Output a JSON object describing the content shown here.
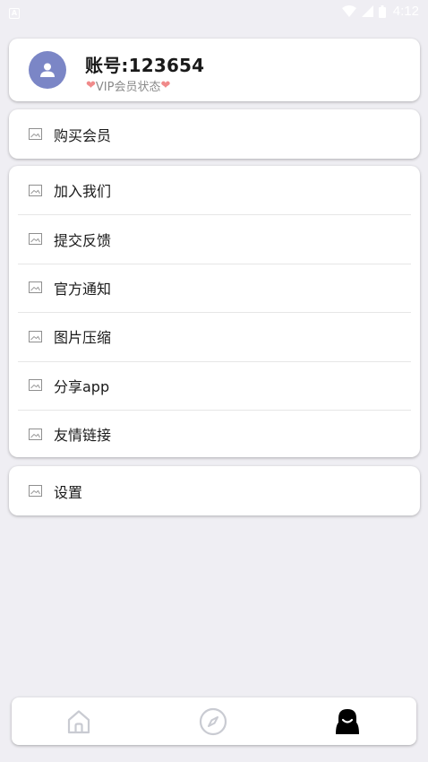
{
  "status_bar": {
    "notification_icon": "a-box-icon",
    "wifi_icon": "wifi-icon",
    "signal_icon": "signal-icon",
    "battery_icon": "battery-icon",
    "time": "4:12"
  },
  "profile": {
    "avatar_icon": "user-icon",
    "account_title": "账号:123654",
    "vip_status": "VIP会员状态",
    "heart_color": "#f08a8a"
  },
  "buy_section": {
    "items": [
      {
        "label": "购买会员",
        "icon": "image-placeholder-icon"
      }
    ]
  },
  "list_section": {
    "items": [
      {
        "label": "加入我们",
        "icon": "image-placeholder-icon"
      },
      {
        "label": "提交反馈",
        "icon": "image-placeholder-icon"
      },
      {
        "label": "官方通知",
        "icon": "image-placeholder-icon"
      },
      {
        "label": "图片压缩",
        "icon": "image-placeholder-icon"
      },
      {
        "label": "分享app",
        "icon": "image-placeholder-icon"
      },
      {
        "label": "友情链接",
        "icon": "image-placeholder-icon"
      }
    ]
  },
  "settings_section": {
    "items": [
      {
        "label": "设置",
        "icon": "image-placeholder-icon"
      }
    ]
  },
  "tab_bar": {
    "tabs": [
      {
        "icon": "home-icon",
        "active": false
      },
      {
        "icon": "compass-icon",
        "active": false
      },
      {
        "icon": "profile-face-icon",
        "active": true
      }
    ],
    "inactive_color": "#c9cbd2",
    "active_color": "#000000"
  },
  "colors": {
    "background": "#efeef3",
    "avatar": "#7b86c6"
  }
}
